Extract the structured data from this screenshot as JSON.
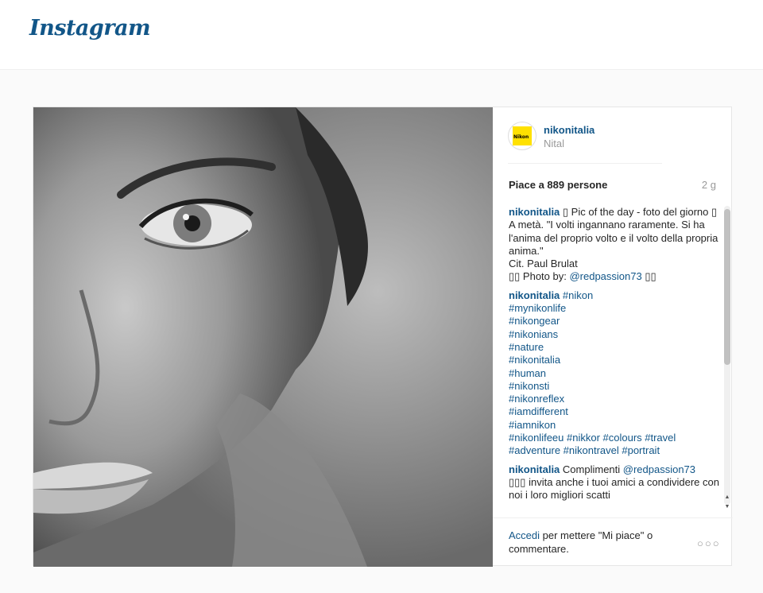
{
  "header": {
    "logo": "Instagram"
  },
  "post": {
    "username": "nikonitalia",
    "location": "Nital",
    "likes": "Piace a 889 persone",
    "age": "2 g",
    "avatar_brand": "Nikon",
    "comments": [
      {
        "author": "nikonitalia",
        "text": " ▯ Pic of the day - foto del giorno ▯\nA metà. \"I volti ingannano raramente. Si ha l'anima del proprio volto e il volto della propria anima.\"\nCit. Paul Brulat\n▯▯ Photo by: ",
        "mention": "@redpassion73",
        "after": " ▯▯"
      },
      {
        "author": "nikonitalia",
        "text": " ",
        "tags": "#nikon\n#mynikonlife\n#nikongear\n#nikonians\n#nature\n#nikonitalia\n#human\n#nikonsti\n#nikonreflex\n#iamdifferent\n#iamnikon\n#nikonlifeeu #nikkor #colours #travel\n#adventure #nikontravel #portrait"
      },
      {
        "author": "nikonitalia",
        "text": " Complimenti ",
        "mention": "@redpassion73",
        "after": "\n▯▯▯ invita anche i tuoi amici a condividere con noi i loro migliori scatti"
      }
    ]
  },
  "footer": {
    "login_link": "Accedi",
    "login_text": " per mettere \"Mi piace\" o commentare.",
    "more": "○○○"
  },
  "colors": {
    "accent": "#125688",
    "muted": "#999999"
  }
}
